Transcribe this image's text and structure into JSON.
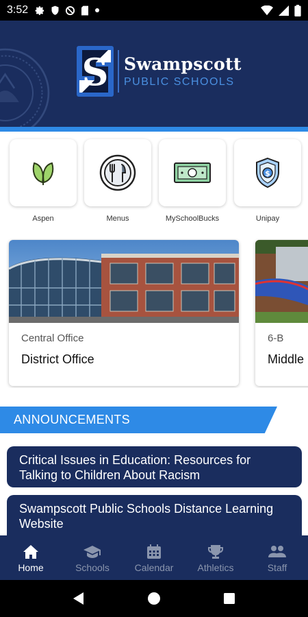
{
  "status_bar": {
    "time": "3:52",
    "icons": [
      "gear-icon",
      "shield-icon",
      "blocked-icon",
      "sd-card-icon",
      "dot-icon"
    ],
    "right_icons": [
      "wifi-icon",
      "signal-icon",
      "battery-icon"
    ]
  },
  "header": {
    "logo_letter": "S",
    "name": "Swampscott",
    "subtitle": "PUBLIC SCHOOLS"
  },
  "quick_links": [
    {
      "label": "Aspen",
      "icon": "leaf-icon"
    },
    {
      "label": "Menus",
      "icon": "plate-utensils-icon"
    },
    {
      "label": "MySchoolBucks",
      "icon": "money-bill-icon"
    },
    {
      "label": "Unipay",
      "icon": "dollar-shield-icon"
    }
  ],
  "schools": [
    {
      "subtitle": "Central Office",
      "title": "District Office"
    },
    {
      "subtitle": "6-B",
      "title": "Middle"
    }
  ],
  "announcements": {
    "heading": "ANNOUNCEMENTS",
    "items": [
      {
        "text": "Critical Issues in Education: Resources for Talking to Children About Racism"
      },
      {
        "text": "Swampscott Public Schools Distance Learning Website"
      }
    ]
  },
  "bottom_nav": {
    "active": "Home",
    "items": [
      {
        "label": "Home",
        "icon": "home-icon"
      },
      {
        "label": "Schools",
        "icon": "graduation-cap-icon"
      },
      {
        "label": "Calendar",
        "icon": "calendar-icon"
      },
      {
        "label": "Athletics",
        "icon": "trophy-icon"
      },
      {
        "label": "Staff",
        "icon": "users-icon"
      }
    ]
  },
  "colors": {
    "navy": "#1a2d5e",
    "accent_blue": "#2e8ae6",
    "inactive_nav": "#8a95ad"
  }
}
